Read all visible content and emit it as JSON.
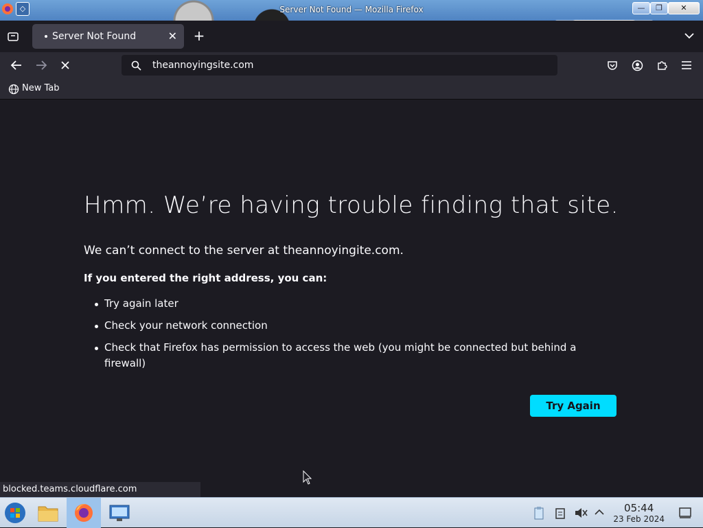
{
  "window": {
    "title": "Server Not Found — Mozilla Firefox",
    "controls": {
      "minimize": "—",
      "maximize": "❐",
      "close": "✕"
    }
  },
  "tabs": [
    {
      "label": "Server Not Found"
    }
  ],
  "toolbar": {
    "url": "theannoyingsite.com"
  },
  "bookmarks": [
    {
      "label": "New Tab"
    }
  ],
  "error": {
    "title": "Hmm. We’re having trouble finding that site.",
    "description": "We can’t connect to the server at theannoyingite.com.",
    "suggestions_heading": "If you entered the right address, you can:",
    "suggestions": [
      "Try again later",
      "Check your network connection",
      "Check that Firefox has permission to access the web (you might be connected but behind a firewall)"
    ],
    "try_again_label": "Try Again"
  },
  "status_bar": "blocked.teams.cloudflare.com",
  "taskbar": {
    "time": "05:44",
    "date": "23 Feb 2024"
  },
  "icons": [
    "firefox-icon",
    "system-menu-icon",
    "tab-list-icon",
    "new-tab-icon",
    "all-tabs-icon",
    "back-icon",
    "forward-icon",
    "stop-icon",
    "search-icon",
    "pocket-icon",
    "account-icon",
    "extensions-icon",
    "menu-icon",
    "globe-icon",
    "start-icon",
    "file-manager-icon",
    "network-icon",
    "clipboard-icon",
    "volume-muted-icon",
    "tray-expand-icon",
    "show-desktop-icon"
  ],
  "colors": {
    "accent": "#00ddff",
    "background": "#1c1b22",
    "toolbar": "#2b2a33"
  }
}
